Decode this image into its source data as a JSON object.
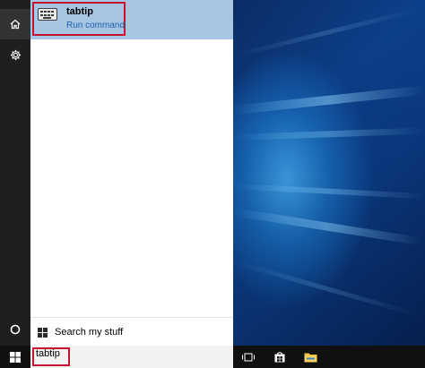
{
  "search_result": {
    "title": "tabtip",
    "subtitle": "Run command",
    "icon": "keyboard-icon"
  },
  "rail": {
    "items": [
      {
        "icon": "home-icon"
      },
      {
        "icon": "gear-icon"
      },
      {
        "icon": "cortana-circle-icon"
      }
    ]
  },
  "bottom_link": {
    "label": "Search my stuff",
    "icon": "windows-logo-icon"
  },
  "search_box": {
    "query": "tabtip"
  },
  "taskbar": {
    "items": [
      "start-button",
      "task-view-button",
      "store-button",
      "file-explorer-button"
    ]
  },
  "colors": {
    "highlight": "#a6c6e3",
    "accent_red": "#c8102e",
    "link_blue": "#1b5fa8",
    "rail": "#1f1f1f",
    "taskbar": "#101010"
  }
}
